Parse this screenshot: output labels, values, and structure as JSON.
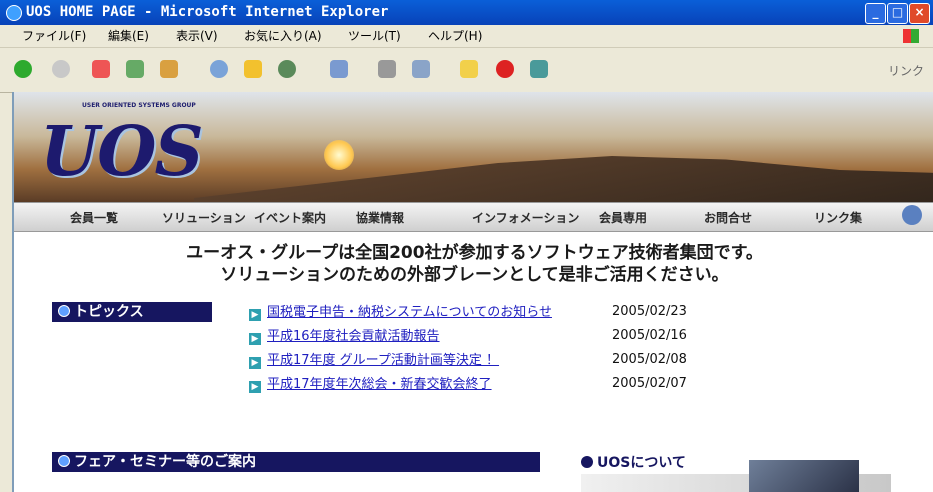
{
  "window": {
    "title": "UOS HOME PAGE - Microsoft Internet Explorer"
  },
  "menu": [
    "ファイル(F)",
    "編集(E)",
    "表示(V)",
    "お気に入り(A)",
    "ツール(T)",
    "ヘルプ(H)"
  ],
  "toolbar": {
    "links_label": "リンク"
  },
  "logo": {
    "tagline": "USER ORIENTED SYSTEMS GROUP",
    "text": "UOS"
  },
  "nav": [
    "会員一覧",
    "ソリューション",
    "イベント案内",
    "協業情報",
    "インフォメーション",
    "会員専用",
    "お問合せ",
    "リンク集"
  ],
  "tagline": [
    "ユーオス・グループは全国200社が参加するソフトウェア技術者集団です。",
    "ソリューションのための外部ブレーンとして是非ご活用ください。"
  ],
  "topics": {
    "heading": "トピックス",
    "items": [
      {
        "title": "国税電子申告・納税システムについてのお知らせ",
        "date": "2005/02/23"
      },
      {
        "title": "平成16年度社会貢献活動報告",
        "date": "2005/02/16"
      },
      {
        "title": "平成17年度 グループ活動計画等決定 ！",
        "date": "2005/02/08"
      },
      {
        "title": "平成17年度年次総会・新春交歓会終了",
        "date": "2005/02/07"
      }
    ]
  },
  "seminar": {
    "heading": "フェア・セミナー等のご案内"
  },
  "about": {
    "heading": "UOSについて"
  }
}
